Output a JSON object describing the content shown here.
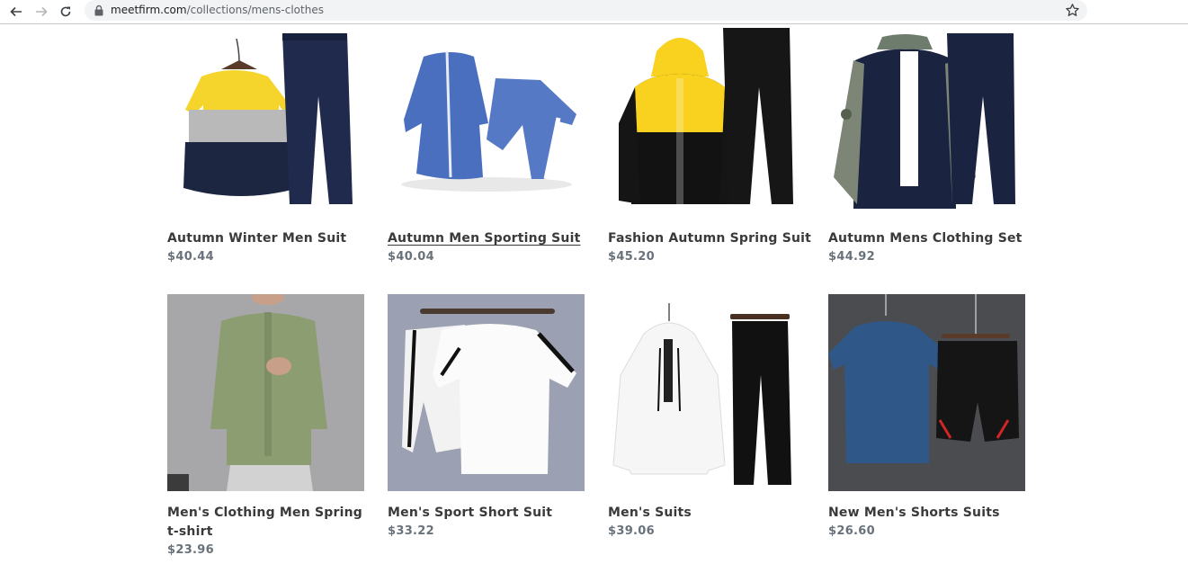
{
  "browser": {
    "url_host": "meetfirm.com",
    "url_path": "/collections/mens-clothes"
  },
  "products": [
    {
      "title": "Autumn Winter Men Suit",
      "price": "$40.44"
    },
    {
      "title": "Autumn Men Sporting Suit",
      "price": "$40.04"
    },
    {
      "title": "Fashion Autumn Spring Suit",
      "price": "$45.20"
    },
    {
      "title": "Autumn Mens Clothing Set",
      "price": "$44.92"
    },
    {
      "title": "Men's Clothing Men Spring t-shirt",
      "price": "$23.96"
    },
    {
      "title": "Men's Sport Short Suit",
      "price": "$33.22"
    },
    {
      "title": "Men's Suits",
      "price": "$39.06"
    },
    {
      "title": "New Men's Shorts Suits",
      "price": "$26.60"
    }
  ]
}
